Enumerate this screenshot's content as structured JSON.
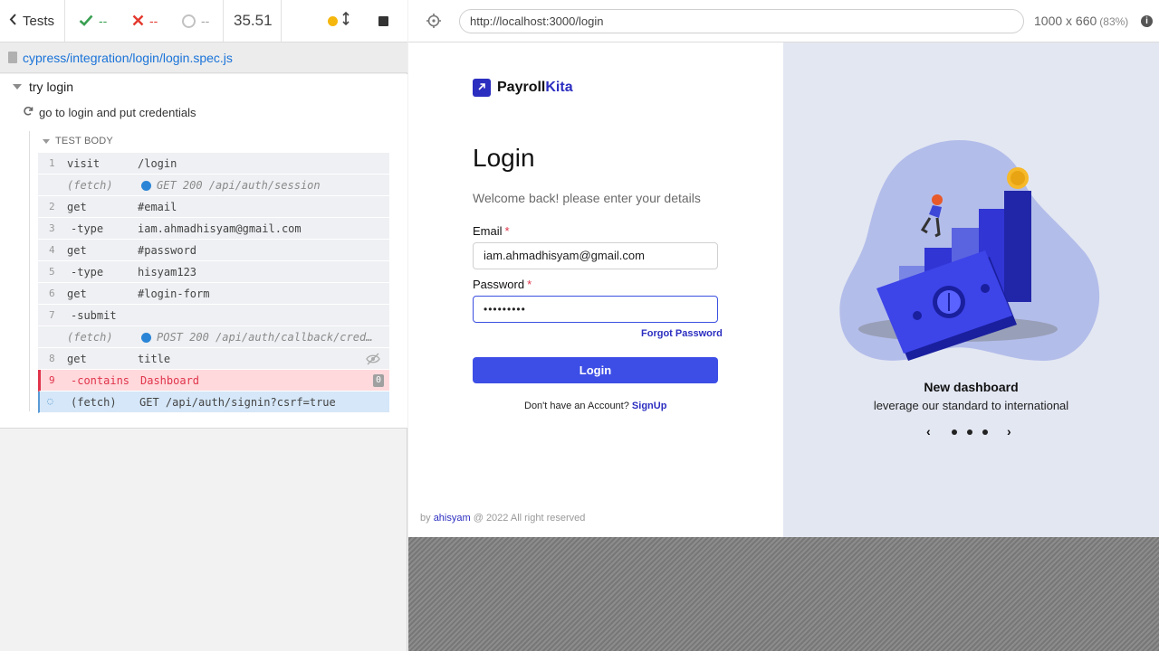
{
  "stats": {
    "tests_label": "Tests",
    "passed": "--",
    "failed": "--",
    "pending": "--",
    "duration": "35.51"
  },
  "spec": {
    "path": "cypress/integration/login/login.spec.js"
  },
  "suite": {
    "title": "try login"
  },
  "test": {
    "title": "go to login and put credentials"
  },
  "section": {
    "label": "TEST BODY"
  },
  "commands": [
    {
      "num": "1",
      "name": "visit",
      "message": "/login",
      "kind": "normal"
    },
    {
      "num": "",
      "name": "(fetch)",
      "message": "GET 200 /api/auth/session",
      "kind": "fetch"
    },
    {
      "num": "2",
      "name": "get",
      "message": "#email",
      "kind": "normal"
    },
    {
      "num": "3",
      "name": "-type",
      "message": "iam.ahmadhisyam@gmail.com",
      "kind": "child"
    },
    {
      "num": "4",
      "name": "get",
      "message": "#password",
      "kind": "normal"
    },
    {
      "num": "5",
      "name": "-type",
      "message": "hisyam123",
      "kind": "child"
    },
    {
      "num": "6",
      "name": "get",
      "message": "#login-form",
      "kind": "normal"
    },
    {
      "num": "7",
      "name": "-submit",
      "message": "",
      "kind": "child"
    },
    {
      "num": "",
      "name": "(fetch)",
      "message": "POST 200 /api/auth/callback/credentials",
      "kind": "fetch"
    },
    {
      "num": "8",
      "name": "get",
      "message": "title",
      "kind": "normal"
    },
    {
      "num": "9",
      "name": "-contains",
      "message": "Dashboard",
      "kind": "failed",
      "badge": "0"
    },
    {
      "num": "",
      "name": "(fetch)",
      "message": "GET /api/auth/signin?csrf=true",
      "kind": "pending"
    }
  ],
  "aut": {
    "url": "http://localhost:3000/login",
    "viewport": "1000 x 660",
    "scale": "(83%)"
  },
  "login_page": {
    "brand_part1": "Payroll",
    "brand_part2": "Kita",
    "title": "Login",
    "subtitle": "Welcome back! please enter your details",
    "email_label": "Email",
    "required_mark": "*",
    "email_value": "iam.ahmadhisyam@gmail.com",
    "password_label": "Password",
    "password_value": "•••••••••",
    "forgot": "Forgot Password",
    "login_button": "Login",
    "no_account": "Don't have an Account?",
    "signup": "SignUp",
    "footer_by": "by",
    "footer_author": "ahisyam",
    "footer_rest": "@ 2022 All right reserved"
  },
  "hero": {
    "title": "New dashboard",
    "subtitle": "leverage our standard to international",
    "prev": "‹",
    "next": "›",
    "dots": 3
  }
}
